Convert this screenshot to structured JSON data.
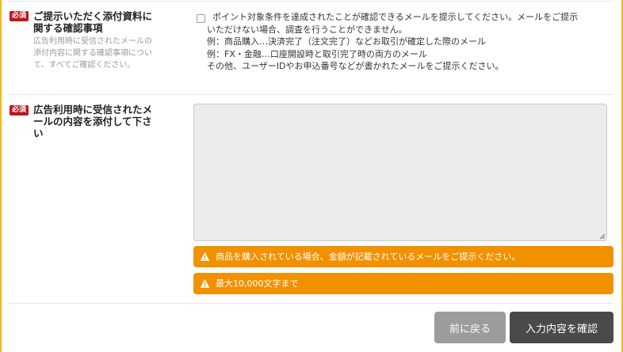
{
  "required_badge": "必須",
  "section1": {
    "title_line1": "ご提示いただく添付資料に",
    "title_line2": "関する確認事項",
    "sub_line1": "広告利用時に受信されたメールの",
    "sub_line2": "添付内容に関する確認事項につい",
    "sub_line3": "て、すべてご確認ください。",
    "consent_lines": [
      "ポイント対象条件を達成されたことが確認できるメールを提示してください。メールをご提示",
      "いただけない場合、調査を行うことができません。",
      "例：商品購入…決済完了（注文完了）などお取引が確定した際のメール",
      "例：FX・金融…口座開設時と取引完了時の両方のメール",
      "その他、ユーザーIDやお申込番号などが書かれたメールをご提示ください。"
    ],
    "checked": false
  },
  "section2": {
    "title_line1": "広告利用時に受信されたメ",
    "title_line2": "ールの内容を添付して下さ",
    "title_line3": "い",
    "textarea_value": "",
    "notice_amount": "商品を購入されている場合、金額が記載されているメールをご提示ください。",
    "notice_limit": "最大10,000文字まで"
  },
  "buttons": {
    "back": "前に戻る",
    "confirm": "入力内容を確認"
  },
  "colors": {
    "frame": "#f3b81c",
    "required": "#c0161c",
    "notice": "#f29100",
    "back_button": "#9c9c9c",
    "confirm_button": "#4a4a4a"
  },
  "icons": [
    "warning-icon",
    "resize-grip-icon"
  ]
}
